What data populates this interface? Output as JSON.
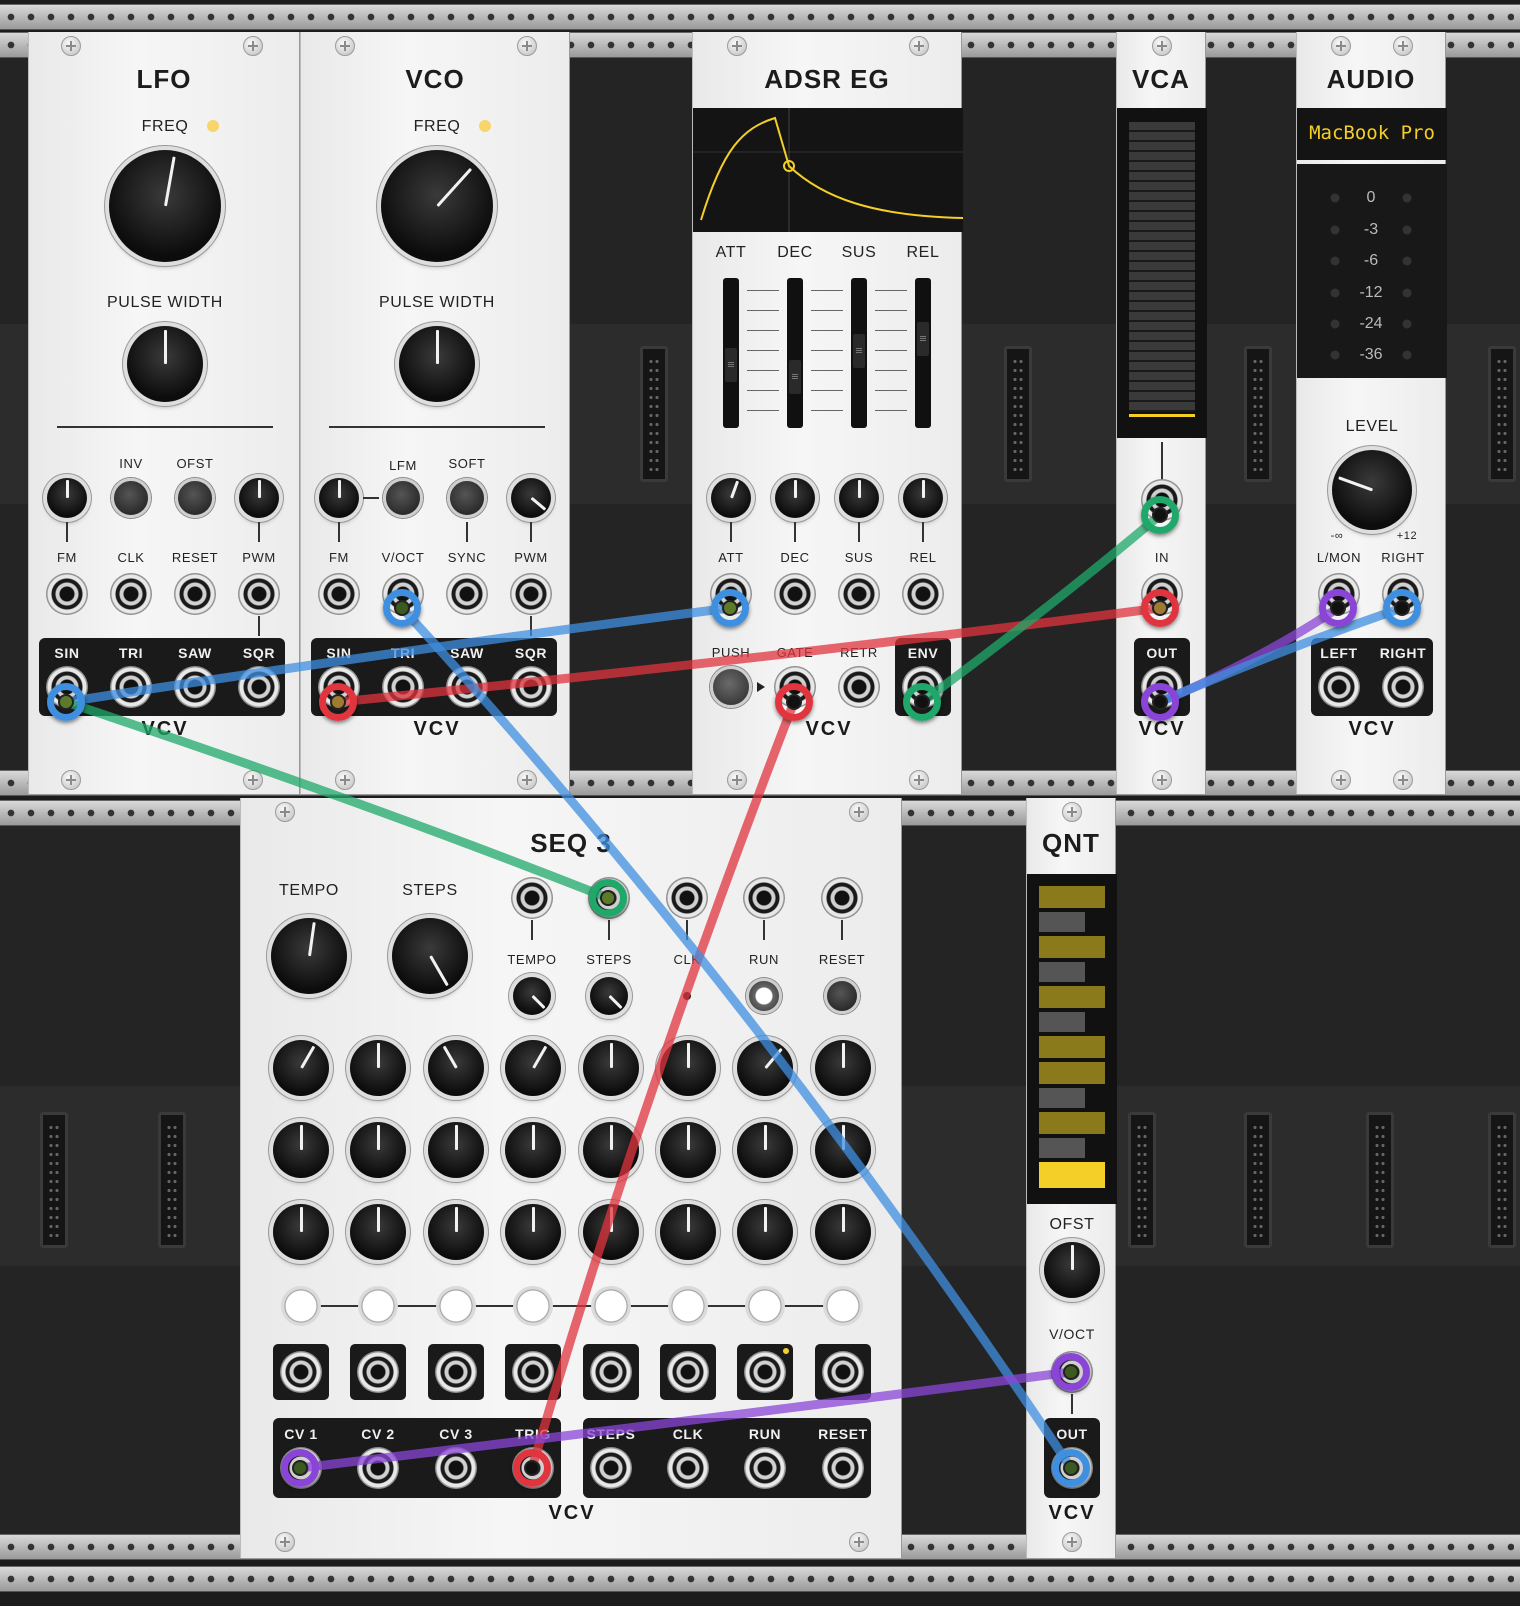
{
  "modules": {
    "lfo": {
      "title": "LFO",
      "freq_label": "FREQ",
      "pulse_width_label": "PULSE WIDTH",
      "inv_label": "INV",
      "ofst_label": "OFST",
      "inputs": [
        "FM",
        "CLK",
        "RESET",
        "PWM"
      ],
      "outputs": [
        "SIN",
        "TRI",
        "SAW",
        "SQR"
      ],
      "logo": "VCV"
    },
    "vco": {
      "title": "VCO",
      "freq_label": "FREQ",
      "pulse_width_label": "PULSE WIDTH",
      "lfm_label": "LFM",
      "soft_label": "SOFT",
      "inputs": [
        "FM",
        "V/OCT",
        "SYNC",
        "PWM"
      ],
      "outputs": [
        "SIN",
        "TRI",
        "SAW",
        "SQR"
      ],
      "logo": "VCV"
    },
    "adsr": {
      "title": "ADSR EG",
      "sliders": [
        "ATT",
        "DEC",
        "SUS",
        "REL"
      ],
      "inputs": [
        "ATT",
        "DEC",
        "SUS",
        "REL"
      ],
      "bottom": [
        "PUSH",
        "GATE",
        "RETR",
        "ENV"
      ],
      "logo": "VCV"
    },
    "vca": {
      "title": "VCA",
      "in_label": "IN",
      "out_label": "OUT",
      "logo": "VCV"
    },
    "audio": {
      "title": "AUDIO",
      "device": "MacBook Pro",
      "meter_labels": [
        "0",
        "-3",
        "-6",
        "-12",
        "-24",
        "-36"
      ],
      "level_label": "LEVEL",
      "level_min": "-∞",
      "level_max": "+12",
      "inputs": [
        "L/MON",
        "RIGHT"
      ],
      "outputs": [
        "LEFT",
        "RIGHT"
      ],
      "logo": "VCV"
    },
    "seq3": {
      "title": "SEQ 3",
      "tempo_label": "TEMPO",
      "steps_label": "STEPS",
      "cv_inputs": [
        "TEMPO",
        "STEPS",
        "CLK",
        "RUN",
        "RESET"
      ],
      "outputs_left": [
        "CV 1",
        "CV 2",
        "CV 3",
        "TRIG"
      ],
      "outputs_right": [
        "STEPS",
        "CLK",
        "RUN",
        "RESET"
      ],
      "logo": "VCV"
    },
    "qnt": {
      "title": "QNT",
      "ofst_label": "OFST",
      "voct_label": "V/OCT",
      "out_label": "OUT",
      "logo": "VCV"
    }
  },
  "colors": {
    "cable_blue": "#3f8fe0",
    "cable_red": "#e0343f",
    "cable_green": "#1fa86a",
    "cable_purple": "#8a45d8",
    "accent_yellow": "#f3cf27"
  }
}
